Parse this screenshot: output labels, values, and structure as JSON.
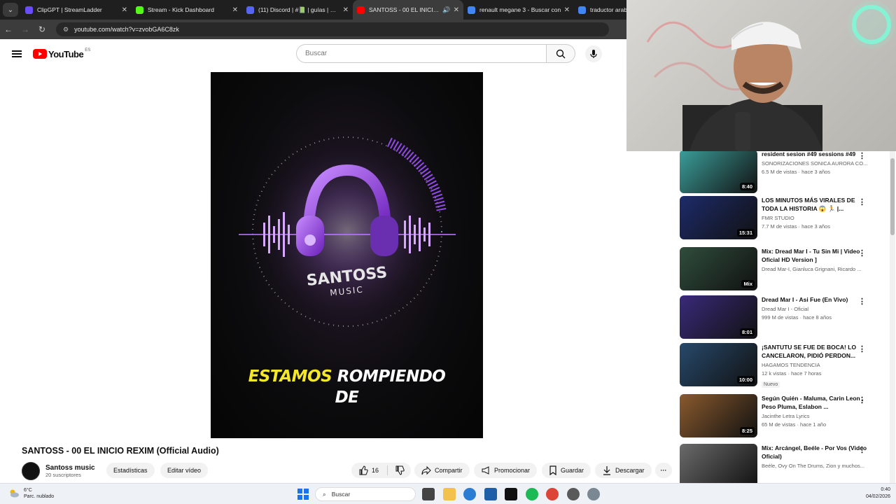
{
  "browser": {
    "tabs": [
      {
        "title": "ClipGPT | StreamLadder",
        "color": "#6a4cff",
        "active": false,
        "audio": false
      },
      {
        "title": "Stream - Kick Dashboard",
        "color": "#53fc18",
        "active": false,
        "audio": false
      },
      {
        "title": "(11) Discord | #📗 | guías | KICK",
        "color": "#5865f2",
        "active": false,
        "audio": false
      },
      {
        "title": "SANTOSS - 00 EL INICIO RE",
        "color": "#ff0000",
        "active": true,
        "audio": true
      },
      {
        "title": "renault megane 3 - Buscar con",
        "color": "#4285f4",
        "active": false,
        "audio": false
      },
      {
        "title": "traductor arabe",
        "color": "#4285f4",
        "active": false,
        "audio": false
      }
    ],
    "url": "youtube.com/watch?v=zvobGA6C8zk"
  },
  "youtube": {
    "logo_text": "YouTube",
    "country": "ES",
    "search_placeholder": "Buscar"
  },
  "video": {
    "brand": "SANTOSS",
    "brand_sub": "MUSIC",
    "caption_yellow": "ESTAMOS",
    "caption_white": "ROMPIENDO",
    "caption_line2": "DE",
    "title": "SANTOSS - 00 EL INICIO REXIM (Official Audio)",
    "channel": "Santoss music",
    "subscribers": "20 suscriptores",
    "stats_button": "Estadísticas",
    "edit_button": "Editar vídeo",
    "likes": "16",
    "share": "Compartir",
    "promote": "Promocionar",
    "save": "Guardar",
    "download": "Descargar"
  },
  "sidebar": {
    "items": [
      {
        "title": "resident sesion #49 sessions #49",
        "channel": "SONORIZACIONES SONICA AURORA CO...",
        "views": "6.5 M de vistas · hace 3 años",
        "duration": "8:40",
        "thumb": "#3b9e9a",
        "badge": ""
      },
      {
        "title": "LOS MINUTOS MÁS VIRALES DE TODA LA HISTORIA 😱 🏃 |...",
        "channel": "FMR STUDIO",
        "views": "7.7 M de vistas · hace 3 años",
        "duration": "15:31",
        "thumb": "#1d2b6a",
        "badge": ""
      },
      {
        "title": "Mix: Dread Mar I - Tu Sin Mi | Video Oficial HD Version ]",
        "channel": "Dread Mar-I, Gianluca Grignani, Ricardo ...",
        "views": "",
        "duration": "Mix",
        "thumb": "#2f4d3c",
        "badge": ""
      },
      {
        "title": "Dread Mar I - Asi Fue (En Vivo)",
        "channel": "Dread Mar I - Oficial",
        "views": "999 M de vistas · hace 8 años",
        "duration": "8:01",
        "thumb": "#3a2a7a",
        "badge": ""
      },
      {
        "title": "¡SANTUTU SE FUE DE BOCA! LO CANCELARON, PIDIÓ PERDON...",
        "channel": "HAGAMOS TENDENCIA",
        "views": "12 k vistas · hace 7 horas",
        "duration": "10:00",
        "thumb": "#27496b",
        "badge": "Nuevo"
      },
      {
        "title": "Según Quién - Maluma, Carin Leon , Peso Pluma, Eslabon ...",
        "channel": "Jacinthe Letra Lyrics",
        "views": "65 M de vistas · hace 1 año",
        "duration": "8:25",
        "thumb": "#8a5a2e",
        "badge": ""
      },
      {
        "title": "Mix: Arcángel, Beéle - Por Vos (Video Oficial)",
        "channel": "Beéle, Ovy On The Drums, Zion y muchos...",
        "views": "",
        "duration": "",
        "thumb": "#6b6b6b",
        "badge": ""
      }
    ]
  },
  "taskbar": {
    "temp": "6°C",
    "weather": "Parc. nublado",
    "search": "Buscar",
    "time": "0:40",
    "date": "04/02/2026"
  }
}
